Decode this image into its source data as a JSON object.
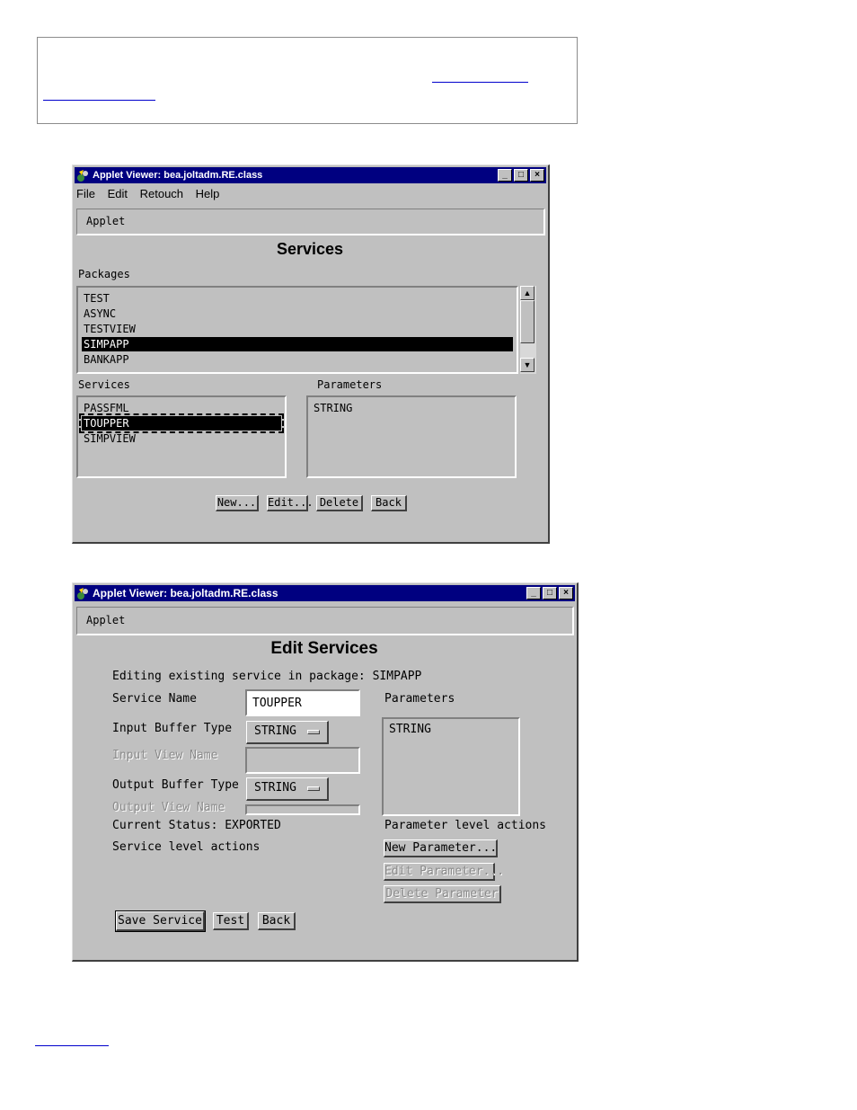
{
  "links": {
    "top_link_part1": "",
    "top_link_part2": "",
    "bottom_link": ""
  },
  "window1": {
    "title": "Applet Viewer: bea.joltadm.RE.class",
    "menu": [
      "File",
      "Edit",
      "Retouch",
      "Help"
    ],
    "applet_label": "Applet",
    "heading": "Services",
    "packages_label": "Packages",
    "packages": [
      "TEST",
      "ASYNC",
      "TESTVIEW",
      "SIMPAPP",
      "BANKAPP"
    ],
    "selected_package": "SIMPAPP",
    "services_label": "Services",
    "services": [
      "PASSFML",
      "TOUPPER",
      "SIMPVIEW"
    ],
    "selected_service": "TOUPPER",
    "parameters_label": "Parameters",
    "parameters": [
      "STRING"
    ],
    "buttons": {
      "new": "New...",
      "edit": "Edit...",
      "delete": "Delete",
      "back": "Back"
    }
  },
  "window2": {
    "title": "Applet Viewer: bea.joltadm.RE.class",
    "applet_label": "Applet",
    "heading": "Edit Services",
    "editing_text": "Editing existing service in package: SIMPAPP",
    "service_name_label": "Service Name",
    "service_name_value": "TOUPPER",
    "input_buffer_label": "Input Buffer Type",
    "input_buffer_value": "STRING",
    "input_view_label": "Input View Name",
    "output_buffer_label": "Output Buffer Type",
    "output_buffer_value": "STRING",
    "output_view_label": "Output View Name",
    "status_text": "Current Status: EXPORTED",
    "service_actions_label": "Service level actions",
    "parameters_label": "Parameters",
    "parameters": [
      "STRING"
    ],
    "param_actions_label": "Parameter level actions",
    "buttons": {
      "new_parameter": "New Parameter...",
      "edit_parameter": "Edit Parameter...",
      "delete_parameter": "Delete Parameter",
      "save_service": "Save Service",
      "test": "Test",
      "back": "Back"
    }
  },
  "colors": {
    "titlebar": "#000080",
    "window_face": "#c0c0c0",
    "link": "#0000ee"
  }
}
